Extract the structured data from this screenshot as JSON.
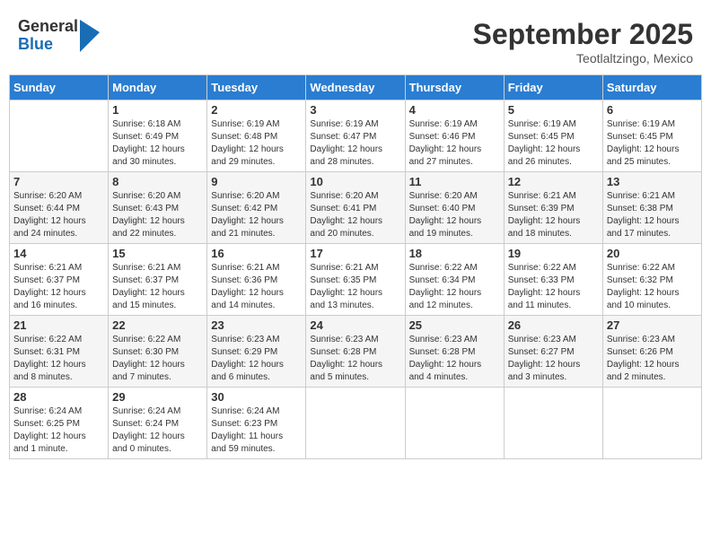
{
  "logo": {
    "general": "General",
    "blue": "Blue"
  },
  "title": "September 2025",
  "subtitle": "Teotlaltzingo, Mexico",
  "days": {
    "headers": [
      "Sunday",
      "Monday",
      "Tuesday",
      "Wednesday",
      "Thursday",
      "Friday",
      "Saturday"
    ]
  },
  "weeks": [
    [
      {
        "day": "",
        "info": ""
      },
      {
        "day": "1",
        "info": "Sunrise: 6:18 AM\nSunset: 6:49 PM\nDaylight: 12 hours\nand 30 minutes."
      },
      {
        "day": "2",
        "info": "Sunrise: 6:19 AM\nSunset: 6:48 PM\nDaylight: 12 hours\nand 29 minutes."
      },
      {
        "day": "3",
        "info": "Sunrise: 6:19 AM\nSunset: 6:47 PM\nDaylight: 12 hours\nand 28 minutes."
      },
      {
        "day": "4",
        "info": "Sunrise: 6:19 AM\nSunset: 6:46 PM\nDaylight: 12 hours\nand 27 minutes."
      },
      {
        "day": "5",
        "info": "Sunrise: 6:19 AM\nSunset: 6:45 PM\nDaylight: 12 hours\nand 26 minutes."
      },
      {
        "day": "6",
        "info": "Sunrise: 6:19 AM\nSunset: 6:45 PM\nDaylight: 12 hours\nand 25 minutes."
      }
    ],
    [
      {
        "day": "7",
        "info": "Sunrise: 6:20 AM\nSunset: 6:44 PM\nDaylight: 12 hours\nand 24 minutes."
      },
      {
        "day": "8",
        "info": "Sunrise: 6:20 AM\nSunset: 6:43 PM\nDaylight: 12 hours\nand 22 minutes."
      },
      {
        "day": "9",
        "info": "Sunrise: 6:20 AM\nSunset: 6:42 PM\nDaylight: 12 hours\nand 21 minutes."
      },
      {
        "day": "10",
        "info": "Sunrise: 6:20 AM\nSunset: 6:41 PM\nDaylight: 12 hours\nand 20 minutes."
      },
      {
        "day": "11",
        "info": "Sunrise: 6:20 AM\nSunset: 6:40 PM\nDaylight: 12 hours\nand 19 minutes."
      },
      {
        "day": "12",
        "info": "Sunrise: 6:21 AM\nSunset: 6:39 PM\nDaylight: 12 hours\nand 18 minutes."
      },
      {
        "day": "13",
        "info": "Sunrise: 6:21 AM\nSunset: 6:38 PM\nDaylight: 12 hours\nand 17 minutes."
      }
    ],
    [
      {
        "day": "14",
        "info": "Sunrise: 6:21 AM\nSunset: 6:37 PM\nDaylight: 12 hours\nand 16 minutes."
      },
      {
        "day": "15",
        "info": "Sunrise: 6:21 AM\nSunset: 6:37 PM\nDaylight: 12 hours\nand 15 minutes."
      },
      {
        "day": "16",
        "info": "Sunrise: 6:21 AM\nSunset: 6:36 PM\nDaylight: 12 hours\nand 14 minutes."
      },
      {
        "day": "17",
        "info": "Sunrise: 6:21 AM\nSunset: 6:35 PM\nDaylight: 12 hours\nand 13 minutes."
      },
      {
        "day": "18",
        "info": "Sunrise: 6:22 AM\nSunset: 6:34 PM\nDaylight: 12 hours\nand 12 minutes."
      },
      {
        "day": "19",
        "info": "Sunrise: 6:22 AM\nSunset: 6:33 PM\nDaylight: 12 hours\nand 11 minutes."
      },
      {
        "day": "20",
        "info": "Sunrise: 6:22 AM\nSunset: 6:32 PM\nDaylight: 12 hours\nand 10 minutes."
      }
    ],
    [
      {
        "day": "21",
        "info": "Sunrise: 6:22 AM\nSunset: 6:31 PM\nDaylight: 12 hours\nand 8 minutes."
      },
      {
        "day": "22",
        "info": "Sunrise: 6:22 AM\nSunset: 6:30 PM\nDaylight: 12 hours\nand 7 minutes."
      },
      {
        "day": "23",
        "info": "Sunrise: 6:23 AM\nSunset: 6:29 PM\nDaylight: 12 hours\nand 6 minutes."
      },
      {
        "day": "24",
        "info": "Sunrise: 6:23 AM\nSunset: 6:28 PM\nDaylight: 12 hours\nand 5 minutes."
      },
      {
        "day": "25",
        "info": "Sunrise: 6:23 AM\nSunset: 6:28 PM\nDaylight: 12 hours\nand 4 minutes."
      },
      {
        "day": "26",
        "info": "Sunrise: 6:23 AM\nSunset: 6:27 PM\nDaylight: 12 hours\nand 3 minutes."
      },
      {
        "day": "27",
        "info": "Sunrise: 6:23 AM\nSunset: 6:26 PM\nDaylight: 12 hours\nand 2 minutes."
      }
    ],
    [
      {
        "day": "28",
        "info": "Sunrise: 6:24 AM\nSunset: 6:25 PM\nDaylight: 12 hours\nand 1 minute."
      },
      {
        "day": "29",
        "info": "Sunrise: 6:24 AM\nSunset: 6:24 PM\nDaylight: 12 hours\nand 0 minutes."
      },
      {
        "day": "30",
        "info": "Sunrise: 6:24 AM\nSunset: 6:23 PM\nDaylight: 11 hours\nand 59 minutes."
      },
      {
        "day": "",
        "info": ""
      },
      {
        "day": "",
        "info": ""
      },
      {
        "day": "",
        "info": ""
      },
      {
        "day": "",
        "info": ""
      }
    ]
  ]
}
